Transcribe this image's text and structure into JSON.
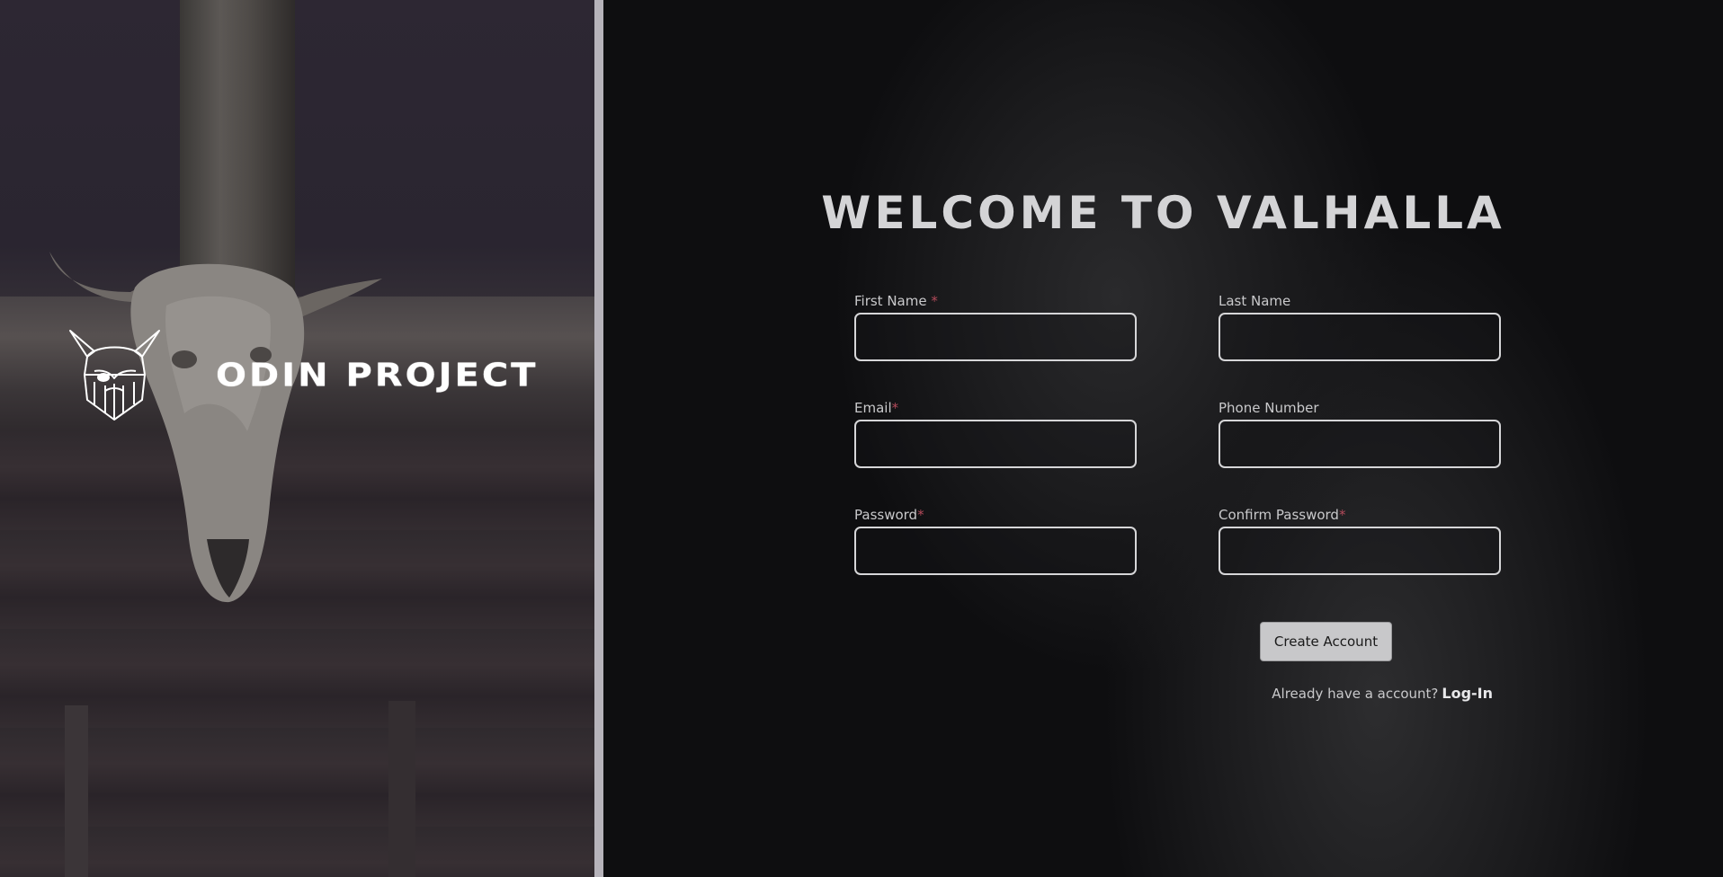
{
  "brand": {
    "title": "ODIN PROJECT"
  },
  "form": {
    "heading": "WELCOME TO VALHALLA",
    "fields": [
      {
        "label": "First Name ",
        "required_mark": "*",
        "value": "",
        "placeholder": ""
      },
      {
        "label": "Last Name",
        "required_mark": "",
        "value": "",
        "placeholder": ""
      },
      {
        "label": "Email",
        "required_mark": "*",
        "value": "",
        "placeholder": ""
      },
      {
        "label": "Phone Number",
        "required_mark": "",
        "value": "",
        "placeholder": ""
      },
      {
        "label": "Password",
        "required_mark": "*",
        "value": "",
        "placeholder": ""
      },
      {
        "label": "Confirm Password",
        "required_mark": "*",
        "value": "",
        "placeholder": ""
      }
    ],
    "submit_label": "Create Account",
    "login_prompt": "Already have a account?",
    "login_link": "Log-In"
  },
  "colors": {
    "required_mark": "#b34a5a",
    "divider": "#b6b3ba",
    "button_bg": "#c8c8ca"
  }
}
